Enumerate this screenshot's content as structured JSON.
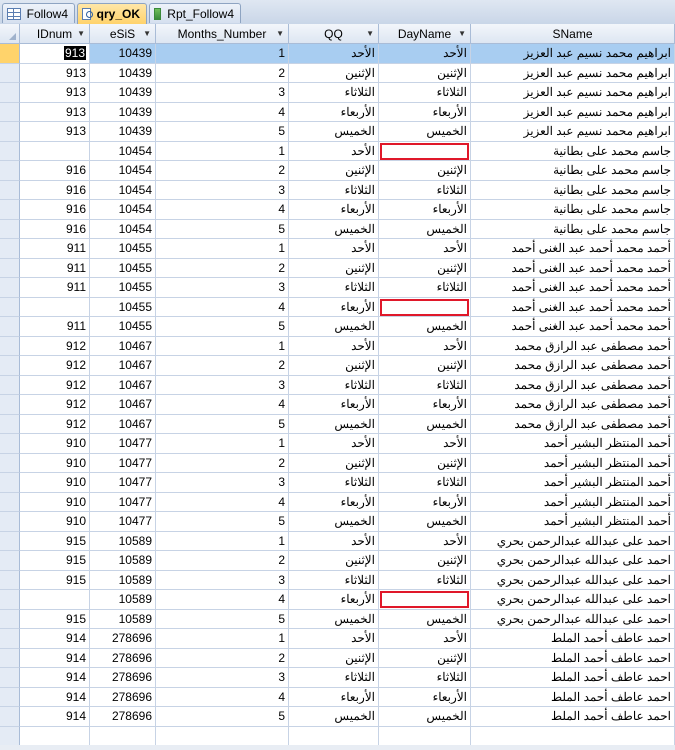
{
  "tabs": [
    {
      "label": "Follow4",
      "icon": "table-icon"
    },
    {
      "label": "qry_OK",
      "icon": "query-icon"
    },
    {
      "label": "Rpt_Follow4",
      "icon": "report-icon"
    }
  ],
  "columns": [
    "IDnum",
    "eSiS",
    "Months_Number",
    "QQ",
    "DayName",
    "SName"
  ],
  "rows": [
    [
      "913",
      "10439",
      "1",
      "الأحد",
      "الأحد",
      "ابراهيم محمد نسيم عبد العزيز"
    ],
    [
      "913",
      "10439",
      "2",
      "الإثنين",
      "الإثنين",
      "ابراهيم محمد نسيم عبد العزيز"
    ],
    [
      "913",
      "10439",
      "3",
      "الثلاثاء",
      "الثلاثاء",
      "ابراهيم محمد نسيم عبد العزيز"
    ],
    [
      "913",
      "10439",
      "4",
      "الأربعاء",
      "الأربعاء",
      "ابراهيم محمد نسيم عبد العزيز"
    ],
    [
      "913",
      "10439",
      "5",
      "الخميس",
      "الخميس",
      "ابراهيم محمد نسيم عبد العزيز"
    ],
    [
      "",
      "10454",
      "1",
      "الأحد",
      "",
      "جاسم محمد على بطانية"
    ],
    [
      "916",
      "10454",
      "2",
      "الإثنين",
      "الإثنين",
      "جاسم محمد على بطانية"
    ],
    [
      "916",
      "10454",
      "3",
      "الثلاثاء",
      "الثلاثاء",
      "جاسم محمد على بطانية"
    ],
    [
      "916",
      "10454",
      "4",
      "الأربعاء",
      "الأربعاء",
      "جاسم محمد على بطانية"
    ],
    [
      "916",
      "10454",
      "5",
      "الخميس",
      "الخميس",
      "جاسم محمد على بطانية"
    ],
    [
      "911",
      "10455",
      "1",
      "الأحد",
      "الأحد",
      "أحمد محمد أحمد عبد الغنى أحمد"
    ],
    [
      "911",
      "10455",
      "2",
      "الإثنين",
      "الإثنين",
      "أحمد محمد أحمد عبد الغنى أحمد"
    ],
    [
      "911",
      "10455",
      "3",
      "الثلاثاء",
      "الثلاثاء",
      "أحمد محمد أحمد عبد الغنى أحمد"
    ],
    [
      "",
      "10455",
      "4",
      "الأربعاء",
      "",
      "أحمد محمد أحمد عبد الغنى أحمد"
    ],
    [
      "911",
      "10455",
      "5",
      "الخميس",
      "الخميس",
      "أحمد محمد أحمد عبد الغنى أحمد"
    ],
    [
      "912",
      "10467",
      "1",
      "الأحد",
      "الأحد",
      "أحمد مصطفى عبد الرازق محمد"
    ],
    [
      "912",
      "10467",
      "2",
      "الإثنين",
      "الإثنين",
      "أحمد مصطفى عبد الرازق محمد"
    ],
    [
      "912",
      "10467",
      "3",
      "الثلاثاء",
      "الثلاثاء",
      "أحمد مصطفى عبد الرازق محمد"
    ],
    [
      "912",
      "10467",
      "4",
      "الأربعاء",
      "الأربعاء",
      "أحمد مصطفى عبد الرازق محمد"
    ],
    [
      "912",
      "10467",
      "5",
      "الخميس",
      "الخميس",
      "أحمد مصطفى عبد الرازق محمد"
    ],
    [
      "910",
      "10477",
      "1",
      "الأحد",
      "الأحد",
      "أحمد المنتظر البشير أحمد"
    ],
    [
      "910",
      "10477",
      "2",
      "الإثنين",
      "الإثنين",
      "أحمد المنتظر البشير أحمد"
    ],
    [
      "910",
      "10477",
      "3",
      "الثلاثاء",
      "الثلاثاء",
      "أحمد المنتظر البشير أحمد"
    ],
    [
      "910",
      "10477",
      "4",
      "الأربعاء",
      "الأربعاء",
      "أحمد المنتظر البشير أحمد"
    ],
    [
      "910",
      "10477",
      "5",
      "الخميس",
      "الخميس",
      "أحمد المنتظر البشير أحمد"
    ],
    [
      "915",
      "10589",
      "1",
      "الأحد",
      "الأحد",
      "احمد على عبدالله عبدالرحمن بحري"
    ],
    [
      "915",
      "10589",
      "2",
      "الإثنين",
      "الإثنين",
      "احمد على عبدالله عبدالرحمن بحري"
    ],
    [
      "915",
      "10589",
      "3",
      "الثلاثاء",
      "الثلاثاء",
      "احمد على عبدالله عبدالرحمن بحري"
    ],
    [
      "",
      "10589",
      "4",
      "الأربعاء",
      "",
      "احمد على عبدالله عبدالرحمن بحري"
    ],
    [
      "915",
      "10589",
      "5",
      "الخميس",
      "الخميس",
      "احمد على عبدالله عبدالرحمن بحري"
    ],
    [
      "914",
      "278696",
      "1",
      "الأحد",
      "الأحد",
      "احمد عاطف أحمد الملط"
    ],
    [
      "914",
      "278696",
      "2",
      "الإثنين",
      "الإثنين",
      "احمد عاطف أحمد الملط"
    ],
    [
      "914",
      "278696",
      "3",
      "الثلاثاء",
      "الثلاثاء",
      "احمد عاطف أحمد الملط"
    ],
    [
      "914",
      "278696",
      "4",
      "الأربعاء",
      "الأربعاء",
      "احمد عاطف أحمد الملط"
    ],
    [
      "914",
      "278696",
      "5",
      "الخميس",
      "الخميس",
      "احمد عاطف أحمد الملط"
    ]
  ],
  "selected_row": 0,
  "highlighted_rows": [
    5,
    13,
    28
  ],
  "colors": {
    "selection": "#a8cdf1",
    "highlight_border": "#e0182a",
    "active_tab": "#ffd36b"
  }
}
